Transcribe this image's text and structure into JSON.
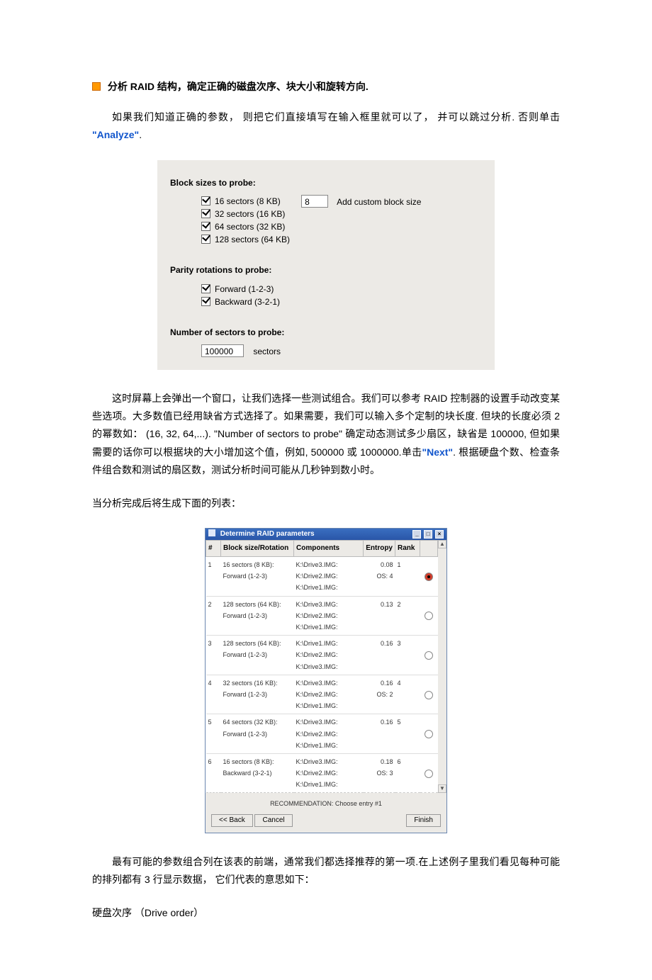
{
  "head": {
    "title": "分析 RAID 结构，确定正确的磁盘次序、块大小和旋转方向."
  },
  "paras": {
    "p1a": "如果我们知道正确的参数， 则把它们直接填写在输入框里就可以了， 并可以跳过分析. 否则单击",
    "p1b": "\"Analyze\"",
    "p1c": ".",
    "p2a": "这时屏幕上会弹出一个窗口，让我们选择一些测试组合。我们可以参考 RAID 控制器的设置手动改变某些选项。大多数值已经用缺省方式选择了。如果需要，我们可以输入多个定制的块长度. 但块的长度必须 2 的幂数如： (16, 32, 64,...). \"Number of sectors to probe\" 确定动态测试多少扇区，缺省是 100000, 但如果需要的话你可以根据块的大小增加这个值，例如, 500000 或 1000000.单击",
    "p2b": "\"Next\"",
    "p2c": ". 根据硬盘个数、检查条件组合数和测试的扇区数，测试分析时间可能从几秒钟到数小时。",
    "p3": "当分析完成后将生成下面的列表：",
    "p4": "最有可能的参数组合列在该表的前端，通常我们都选择推荐的第一项.在上述例子里我们看见每种可能的排列都有 3 行显示数据， 它们代表的意思如下：",
    "p5": "硬盘次序 （Drive order）"
  },
  "panel1": {
    "g1_title": "Block sizes to probe:",
    "opts": [
      "16 sectors (8 KB)",
      "32 sectors (16 KB)",
      "64 sectors (32 KB)",
      "128 sectors (64 KB)"
    ],
    "custom_value": "8",
    "custom_label": "Add custom block size",
    "g2_title": "Parity rotations to probe:",
    "rot": [
      "Forward (1-2-3)",
      "Backward (3-2-1)"
    ],
    "g3_title": "Number of sectors to probe:",
    "sectors_value": "100000",
    "sectors_suffix": "sectors"
  },
  "win2": {
    "title": "Determine RAID parameters",
    "cols": {
      "num": "#",
      "block": "Block size/Rotation",
      "comp": "Components",
      "ent": "Entropy",
      "rank": "Rank"
    },
    "rows": [
      {
        "n": "1",
        "block": "16 sectors (8 KB):",
        "rot": "Forward (1-2-3)",
        "comp": [
          "K:\\Drive3.IMG:",
          "K:\\Drive2.IMG:",
          "K:\\Drive1.IMG:"
        ],
        "ent": "0.08",
        "os": "OS: 4",
        "rank": "1",
        "sel": true
      },
      {
        "n": "2",
        "block": "128 sectors (64 KB):",
        "rot": "Forward (1-2-3)",
        "comp": [
          "K:\\Drive3.IMG:",
          "K:\\Drive2.IMG:",
          "K:\\Drive1.IMG:"
        ],
        "ent": "0.13",
        "os": "",
        "rank": "2",
        "sel": false
      },
      {
        "n": "3",
        "block": "128 sectors (64 KB):",
        "rot": "Forward (1-2-3)",
        "comp": [
          "K:\\Drive1.IMG:",
          "K:\\Drive2.IMG:",
          "K:\\Drive3.IMG:"
        ],
        "ent": "0.16",
        "os": "",
        "rank": "3",
        "sel": false
      },
      {
        "n": "4",
        "block": "32 sectors (16 KB):",
        "rot": "Forward (1-2-3)",
        "comp": [
          "K:\\Drive3.IMG:",
          "K:\\Drive2.IMG:",
          "K:\\Drive1.IMG:"
        ],
        "ent": "0.16",
        "os": "OS: 2",
        "rank": "4",
        "sel": false
      },
      {
        "n": "5",
        "block": "64 sectors (32 KB):",
        "rot": "Forward (1-2-3)",
        "comp": [
          "K:\\Drive3.IMG:",
          "K:\\Drive2.IMG:",
          "K:\\Drive1.IMG:"
        ],
        "ent": "0.16",
        "os": "",
        "rank": "5",
        "sel": false
      },
      {
        "n": "6",
        "block": "16 sectors (8 KB):",
        "rot": "Backward (3-2-1)",
        "comp": [
          "K:\\Drive3.IMG:",
          "K:\\Drive2.IMG:",
          "K:\\Drive1.IMG:"
        ],
        "ent": "0.18",
        "os": "OS: 3",
        "rank": "6",
        "sel": false
      }
    ],
    "reco": "RECOMMENDATION: Choose entry #1",
    "btn_back": "<< Back",
    "btn_cancel": "Cancel",
    "btn_finish": "Finish"
  }
}
